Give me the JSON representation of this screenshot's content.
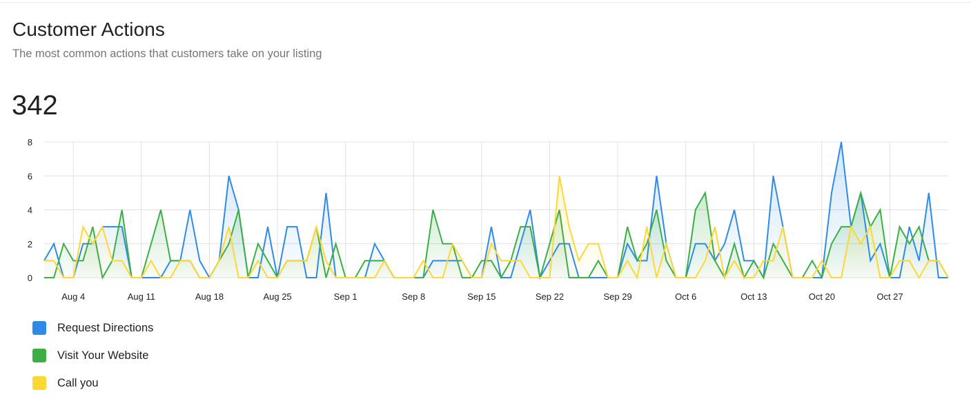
{
  "card": {
    "title": "Customer Actions",
    "subtitle": "The most common actions that customers take on your listing",
    "total": "342"
  },
  "chart_data": {
    "type": "area",
    "title": "Customer Actions",
    "xlabel": "",
    "ylabel": "",
    "ylim": [
      0,
      8
    ],
    "yticks": [
      0,
      2,
      4,
      6,
      8
    ],
    "grid": true,
    "legend_position": "bottom-left",
    "x_start": "Aug 1",
    "x_end": "Nov 2",
    "x_tick_labels": [
      {
        "label": "Aug 4",
        "day_index": 3
      },
      {
        "label": "Aug 11",
        "day_index": 10
      },
      {
        "label": "Aug 18",
        "day_index": 17
      },
      {
        "label": "Aug 25",
        "day_index": 24
      },
      {
        "label": "Sep 1",
        "day_index": 31
      },
      {
        "label": "Sep 8",
        "day_index": 38
      },
      {
        "label": "Sep 15",
        "day_index": 45
      },
      {
        "label": "Sep 22",
        "day_index": 52
      },
      {
        "label": "Sep 29",
        "day_index": 59
      },
      {
        "label": "Oct 6",
        "day_index": 66
      },
      {
        "label": "Oct 13",
        "day_index": 73
      },
      {
        "label": "Oct 20",
        "day_index": 80
      },
      {
        "label": "Oct 27",
        "day_index": 87
      }
    ],
    "series": [
      {
        "name": "Request Directions",
        "color": "#2e8ae6",
        "values": [
          1,
          2,
          0,
          0,
          2,
          2,
          3,
          3,
          3,
          0,
          0,
          0,
          0,
          1,
          1,
          4,
          1,
          0,
          1,
          6,
          4,
          0,
          0,
          3,
          0,
          3,
          3,
          0,
          0,
          5,
          0,
          0,
          0,
          0,
          2,
          1,
          0,
          0,
          0,
          0,
          1,
          1,
          1,
          1,
          0,
          0,
          3,
          0,
          0,
          2,
          4,
          0,
          1,
          2,
          2,
          0,
          0,
          0,
          0,
          0,
          2,
          1,
          1,
          6,
          2,
          0,
          0,
          2,
          2,
          1,
          2,
          4,
          1,
          1,
          0,
          6,
          3,
          0,
          0,
          0,
          0,
          5,
          8,
          3,
          5,
          1,
          2,
          0,
          0,
          3,
          1,
          5,
          0,
          0
        ]
      },
      {
        "name": "Visit Your Website",
        "color": "#3cae45",
        "values": [
          0,
          0,
          2,
          1,
          1,
          3,
          0,
          1,
          4,
          0,
          0,
          2,
          4,
          1,
          1,
          1,
          0,
          0,
          1,
          2,
          4,
          0,
          2,
          1,
          0,
          1,
          1,
          1,
          3,
          0,
          2,
          0,
          0,
          1,
          1,
          1,
          0,
          0,
          0,
          0,
          4,
          2,
          2,
          0,
          0,
          1,
          1,
          0,
          1,
          3,
          3,
          0,
          2,
          4,
          0,
          0,
          0,
          1,
          0,
          0,
          3,
          1,
          2,
          4,
          1,
          0,
          0,
          4,
          5,
          1,
          0,
          2,
          0,
          1,
          0,
          2,
          1,
          0,
          0,
          1,
          0,
          2,
          3,
          3,
          5,
          3,
          4,
          0,
          3,
          2,
          3,
          1,
          1,
          0
        ]
      },
      {
        "name": "Call you",
        "color": "#fdd835",
        "values": [
          1,
          1,
          0,
          0,
          3,
          2,
          3,
          1,
          1,
          0,
          0,
          1,
          0,
          0,
          1,
          1,
          0,
          0,
          1,
          3,
          0,
          0,
          1,
          0,
          0,
          1,
          1,
          1,
          3,
          1,
          0,
          0,
          0,
          0,
          0,
          1,
          0,
          0,
          0,
          1,
          0,
          0,
          2,
          1,
          0,
          0,
          2,
          1,
          1,
          1,
          0,
          0,
          0,
          6,
          3,
          1,
          2,
          2,
          0,
          0,
          1,
          0,
          3,
          0,
          2,
          0,
          0,
          0,
          1,
          3,
          0,
          1,
          0,
          0,
          1,
          1,
          3,
          0,
          0,
          0,
          1,
          0,
          0,
          3,
          2,
          3,
          0,
          0,
          1,
          1,
          0,
          1,
          1,
          0
        ]
      }
    ]
  },
  "legend": [
    {
      "label": "Request Directions",
      "color": "#2e8ae6"
    },
    {
      "label": "Visit Your Website",
      "color": "#3cae45"
    },
    {
      "label": "Call you",
      "color": "#fdd835"
    }
  ]
}
